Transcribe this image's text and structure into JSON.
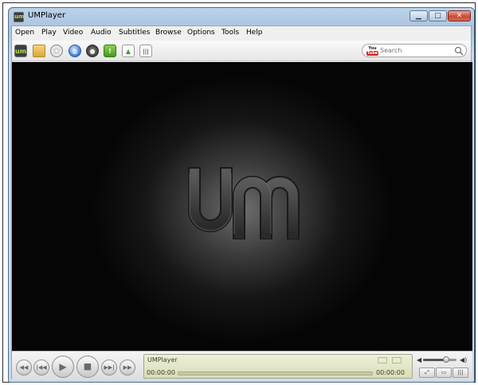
{
  "window": {
    "title": "UMPlayer",
    "app_icon": "um"
  },
  "menu": [
    "Open",
    "Play",
    "Video",
    "Audio",
    "Subtitles",
    "Browse",
    "Options",
    "Tools",
    "Help"
  ],
  "toolbar": {
    "icons": [
      "um-logo-icon",
      "folder-icon",
      "disc-icon",
      "globe-icon",
      "tv-icon",
      "subtitle-icon",
      "upload-icon",
      "equalizer-icon"
    ]
  },
  "search": {
    "badge_top": "You",
    "badge_bottom": "Tube",
    "placeholder": "Search"
  },
  "video": {
    "logo": "um"
  },
  "controls": {
    "now_playing": "UMPlayer",
    "time_current": "00:00:00",
    "time_total": "00:00:00",
    "progress": 0,
    "volume": 0.7
  }
}
